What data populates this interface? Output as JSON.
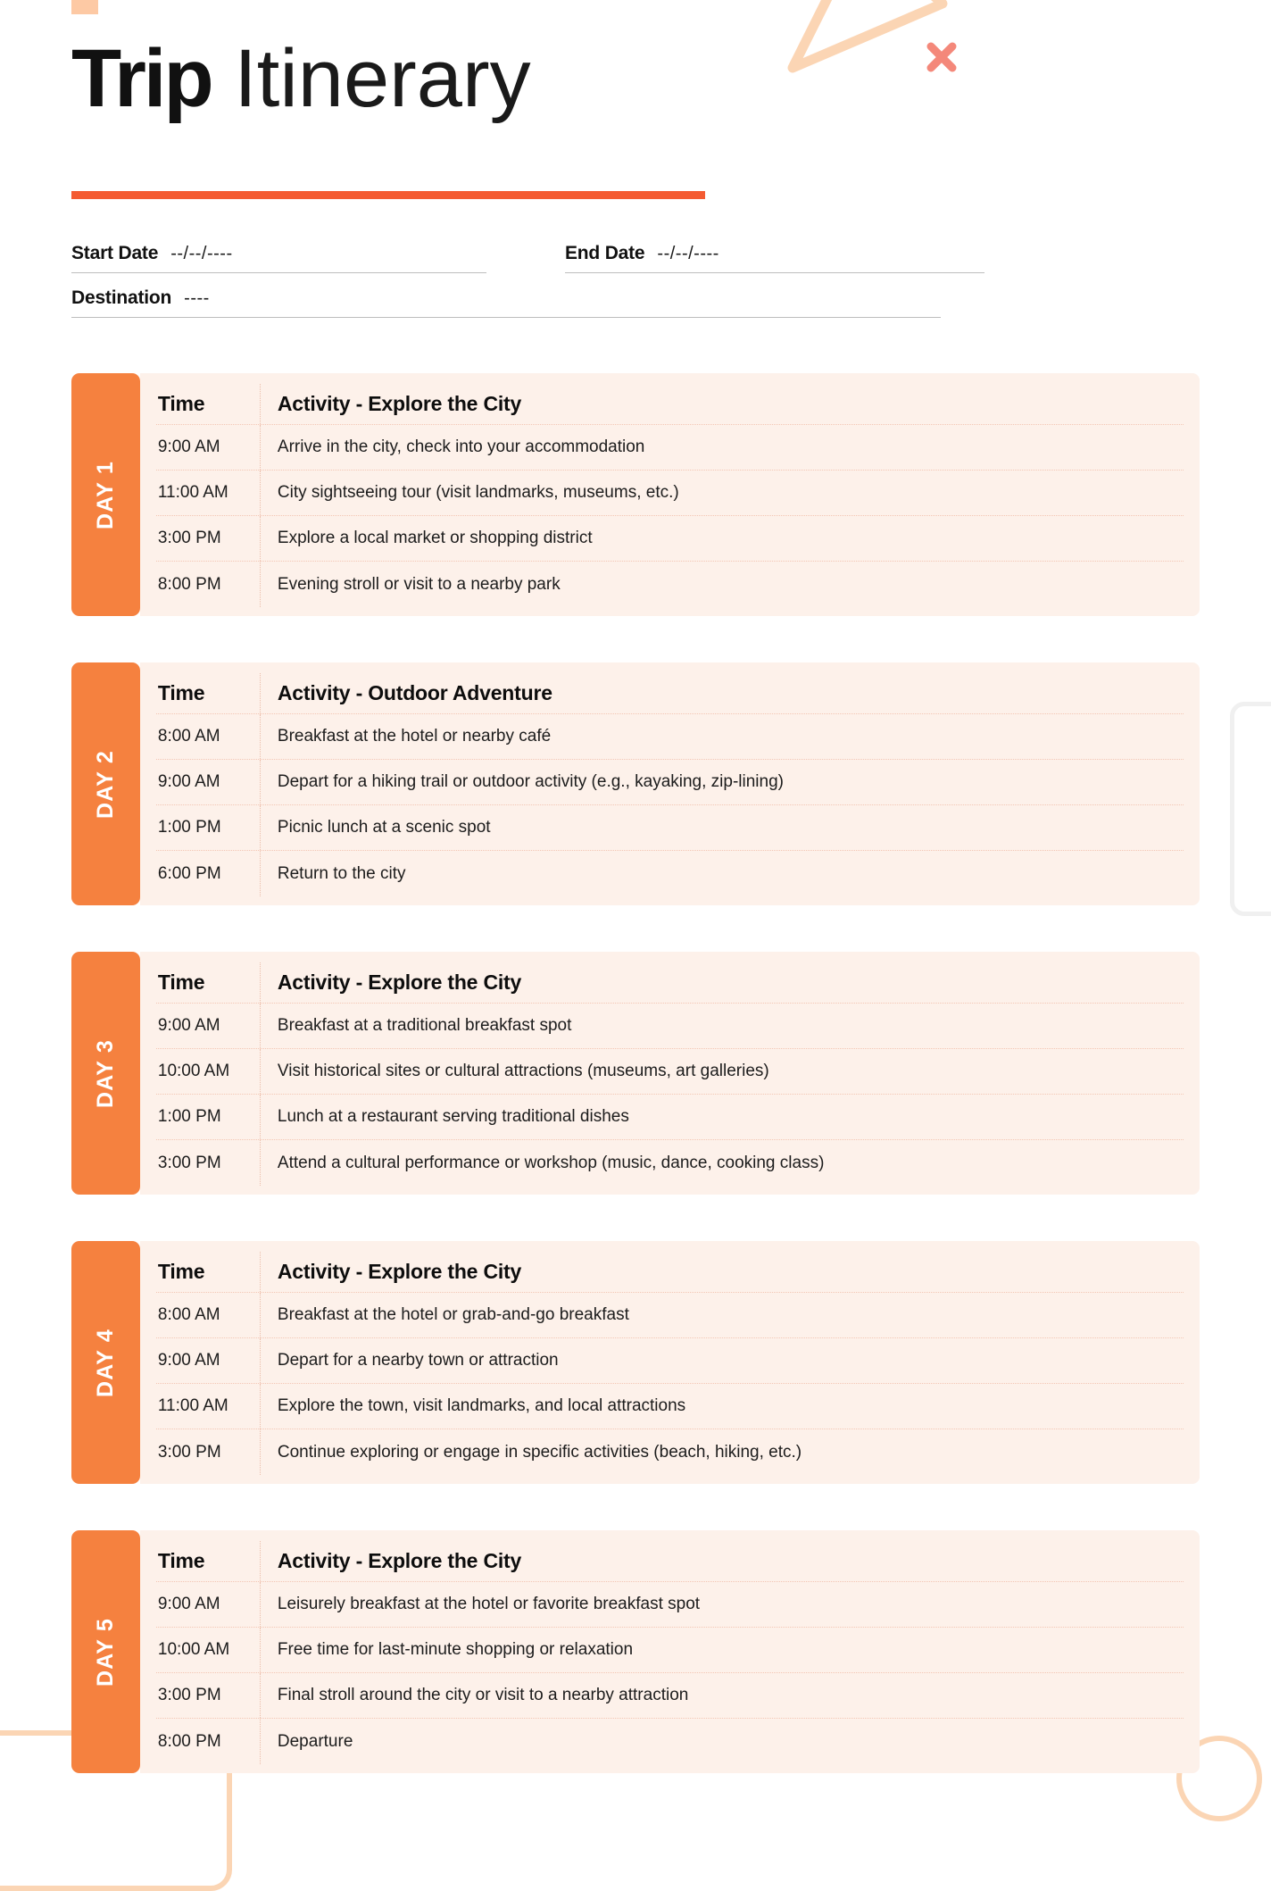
{
  "header": {
    "title_bold": "Trip",
    "title_light": "Itinerary"
  },
  "fields": {
    "start_date_label": "Start Date",
    "start_date_value": "--/--/----",
    "end_date_label": "End Date",
    "end_date_value": "--/--/----",
    "destination_label": "Destination",
    "destination_value": "----"
  },
  "columns": {
    "time": "Time"
  },
  "colors": {
    "accent_rule": "#F45B32",
    "day_tab": "#F5813F",
    "card_bg": "#FDF1EA",
    "deco_peach": "#FBD5B4",
    "x_mark": "#F4887A",
    "square": "#FDC9A4"
  },
  "days": [
    {
      "tab": "DAY 1",
      "activity_header": "Activity - Explore the City",
      "rows": [
        {
          "time": "9:00 AM",
          "activity": "Arrive in the city, check into your accommodation"
        },
        {
          "time": "11:00 AM",
          "activity": "City sightseeing tour (visit landmarks, museums, etc.)"
        },
        {
          "time": "3:00 PM",
          "activity": "Explore a local market or shopping district"
        },
        {
          "time": "8:00 PM",
          "activity": "Evening stroll or visit to a nearby park"
        }
      ]
    },
    {
      "tab": "DAY 2",
      "activity_header": "Activity - Outdoor Adventure",
      "rows": [
        {
          "time": "8:00 AM",
          "activity": "Breakfast at the hotel or nearby café"
        },
        {
          "time": "9:00 AM",
          "activity": "Depart for a hiking trail or outdoor activity (e.g., kayaking, zip-lining)"
        },
        {
          "time": "1:00 PM",
          "activity": "Picnic lunch at a scenic spot"
        },
        {
          "time": "6:00 PM",
          "activity": "Return to the city"
        }
      ]
    },
    {
      "tab": "DAY 3",
      "activity_header": "Activity - Explore the City",
      "rows": [
        {
          "time": "9:00 AM",
          "activity": "Breakfast at a traditional breakfast spot"
        },
        {
          "time": "10:00 AM",
          "activity": "Visit historical sites or cultural attractions (museums, art galleries)"
        },
        {
          "time": "1:00 PM",
          "activity": "Lunch at a restaurant serving traditional dishes"
        },
        {
          "time": "3:00 PM",
          "activity": "Attend a cultural performance or workshop (music, dance, cooking class)"
        }
      ]
    },
    {
      "tab": "DAY 4",
      "activity_header": "Activity - Explore the City",
      "rows": [
        {
          "time": "8:00 AM",
          "activity": "Breakfast at the hotel or grab-and-go breakfast"
        },
        {
          "time": "9:00 AM",
          "activity": "Depart for a nearby town or attraction"
        },
        {
          "time": "11:00 AM",
          "activity": "Explore the town, visit landmarks, and local attractions"
        },
        {
          "time": "3:00 PM",
          "activity": "Continue exploring or engage in specific activities (beach, hiking, etc.)"
        }
      ]
    },
    {
      "tab": "DAY 5",
      "activity_header": "Activity - Explore the City",
      "rows": [
        {
          "time": "9:00 AM",
          "activity": "Leisurely breakfast at the hotel or favorite breakfast spot"
        },
        {
          "time": "10:00 AM",
          "activity": "Free time for last-minute shopping or relaxation"
        },
        {
          "time": "3:00 PM",
          "activity": "Final stroll around the city or visit to a nearby attraction"
        },
        {
          "time": "8:00 PM",
          "activity": "Departure"
        }
      ]
    }
  ]
}
